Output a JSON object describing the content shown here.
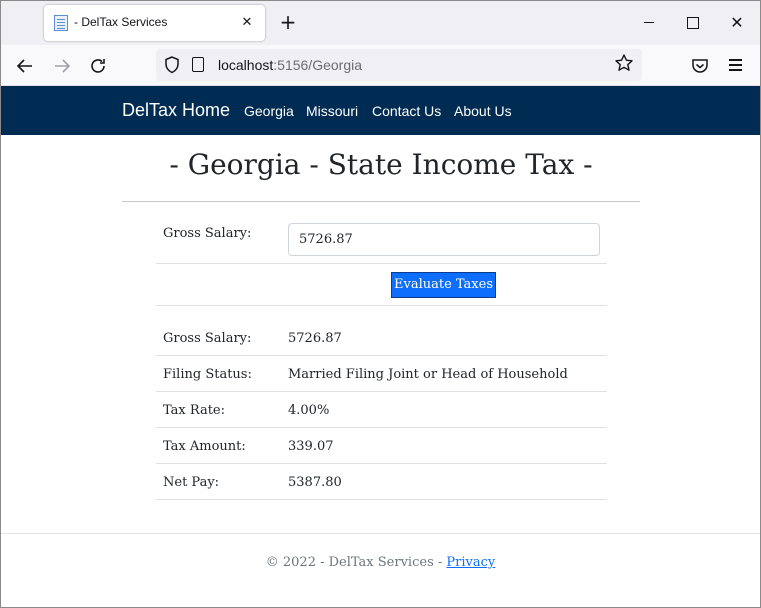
{
  "browser": {
    "tab_title": "- DelTax Services",
    "tab_close_glyph": "✕",
    "new_tab_glyph": "+",
    "close_glyph": "✕",
    "url_host": "localhost",
    "url_rest": ":5156/Georgia",
    "icons": [
      "favicon-icon",
      "tab-close-icon",
      "new-tab-icon",
      "minimize-icon",
      "maximize-icon",
      "close-icon",
      "back-icon",
      "forward-icon",
      "reload-icon",
      "shield-icon",
      "page-icon",
      "bookmark-star-icon",
      "pocket-icon",
      "menu-icon"
    ]
  },
  "navbar": {
    "brand": "DelTax Home",
    "links": [
      "Georgia",
      "Missouri",
      "Contact Us",
      "About Us"
    ],
    "background": "#002b52"
  },
  "main": {
    "title": "- Georgia - State Income Tax -",
    "form": {
      "gross_salary_label": "Gross Salary:",
      "gross_salary_value": "5726.87",
      "button_label": "Evaluate Taxes",
      "button_color": "#0d6efd"
    },
    "results": [
      {
        "label": "Gross Salary:",
        "value": "5726.87"
      },
      {
        "label": "Filing Status:",
        "value": "Married Filing Joint or Head of Household"
      },
      {
        "label": "Tax Rate:",
        "value": "4.00%"
      },
      {
        "label": "Tax Amount:",
        "value": "339.07"
      },
      {
        "label": "Net Pay:",
        "value": "5387.80"
      }
    ]
  },
  "footer": {
    "text": "© 2022 - DelTax Services - ",
    "privacy_link": "Privacy"
  }
}
